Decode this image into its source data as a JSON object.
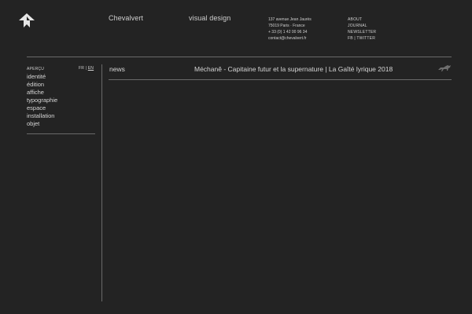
{
  "header": {
    "brand": "Chevalvert",
    "tagline": "visual design",
    "address": {
      "line1": "137 avenue Jean Jaurès",
      "line2": "75019 Paris · France",
      "phone": "+ 33 (0) 1 42 00 96 34",
      "email": "contact@chevalvert.fr"
    },
    "links": {
      "about": "ABOUT",
      "journal": "JOURNAL",
      "newsletter": "NEWSLETTER",
      "fb": "FB",
      "separator": "|",
      "twitter": "TWITTER"
    }
  },
  "sidebar": {
    "heading": "APERÇU",
    "lang": {
      "fr": "FR",
      "separator": "|",
      "en": "EN"
    },
    "items": [
      {
        "label": "identité"
      },
      {
        "label": "édition"
      },
      {
        "label": "affiche"
      },
      {
        "label": "typographie"
      },
      {
        "label": "espace"
      },
      {
        "label": "installation"
      },
      {
        "label": "objet"
      }
    ]
  },
  "main": {
    "section": "news",
    "headline": "Méchanê - Capitaine futur et la supernature | La Gaîté lyrique 2018"
  },
  "colors": {
    "background": "#232323",
    "text": "#d6d6d6",
    "rule": "#6a6a6a"
  }
}
